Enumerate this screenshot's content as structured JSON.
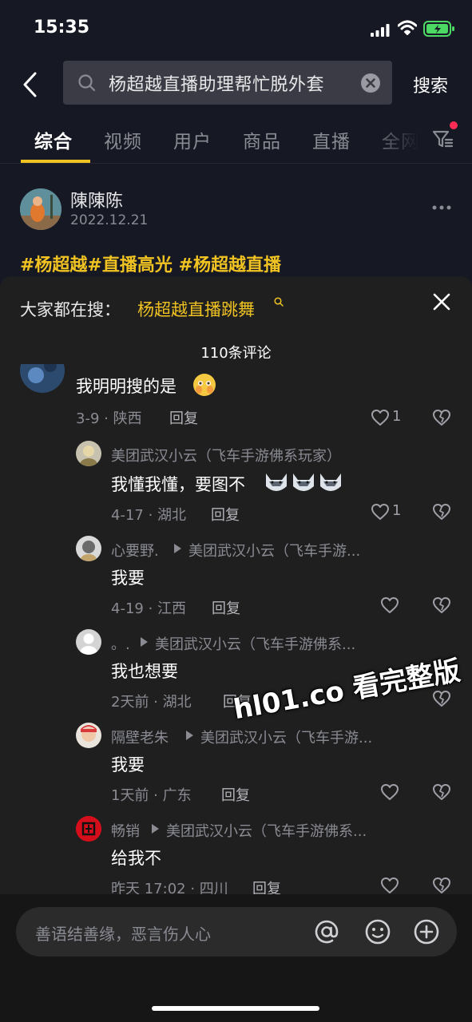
{
  "status_bar": {
    "time": "15:35"
  },
  "search": {
    "query": "杨超越直播助理帮忙脱外套",
    "button_label": "搜索"
  },
  "tabs": [
    {
      "label": "综合",
      "active": true
    },
    {
      "label": "视频"
    },
    {
      "label": "用户"
    },
    {
      "label": "商品"
    },
    {
      "label": "直播"
    },
    {
      "label": "全网"
    }
  ],
  "post": {
    "author": "陳陳陈",
    "date": "2022.12.21",
    "hashtags": "#杨超越#直播高光  #杨超越直播"
  },
  "comment_panel": {
    "hot_search_label": "大家都在搜：",
    "hot_search_link": "杨超越直播跳舞",
    "count_label": "110条评论",
    "comments": [
      {
        "text": "我明明搜的是",
        "meta": "3-9 · 陕西",
        "reply_label": "回复",
        "likes": "1"
      },
      {
        "name": "美团武汉小云（飞车手游佛系玩家）",
        "text": "我懂我懂，要图不",
        "meta": "4-17 · 湖北",
        "reply_label": "回复",
        "likes": "1"
      },
      {
        "name": "心要野.",
        "reply_to": "美团武汉小云（飞车手游...",
        "text": "我要",
        "meta": "4-19 · 江西",
        "reply_label": "回复",
        "likes": ""
      },
      {
        "name": "。.",
        "reply_to": "美团武汉小云（飞车手游佛系...",
        "text": "我也想要",
        "meta": "2天前 · 湖北",
        "reply_label": "回复",
        "likes": ""
      },
      {
        "name": "隔壁老朱",
        "reply_to": "美团武汉小云（飞车手游...",
        "text": "我要",
        "meta": "1天前 · 广东",
        "reply_label": "回复",
        "likes": ""
      },
      {
        "name": "畅销",
        "reply_to": "美团武汉小云（飞车手游佛系...",
        "text": "给我不",
        "meta": "昨天 17:02 · 四川",
        "reply_label": "回复",
        "likes": ""
      }
    ]
  },
  "input": {
    "placeholder": "善语结善缘，恶言伤人心"
  },
  "watermark": "hl01.co 看完整版",
  "colors": {
    "accent": "#f0c322",
    "background": "#161823",
    "panel": "#1f1f1f",
    "badge": "#fe2c55"
  }
}
